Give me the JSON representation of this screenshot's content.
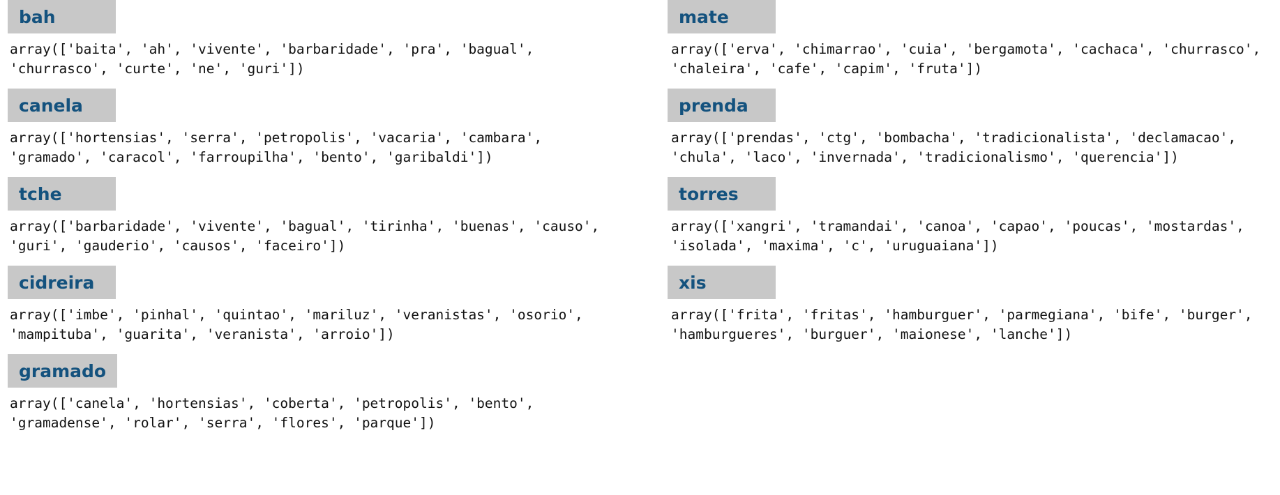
{
  "page": {
    "title": "word association arrays",
    "badge_bg": "#c8c8c8",
    "badge_fg": "#14527e",
    "text_color": "#111111",
    "background": "#ffffff"
  },
  "columns": [
    {
      "name": "left-column",
      "groups": [
        {
          "label": "bah",
          "lines": [
            "array(['baita', 'ah', 'vivente', 'barbaridade', 'pra', 'bagual',",
            "'churrasco', 'curte', 'ne', 'guri'])"
          ],
          "items": [
            "baita",
            "ah",
            "vivente",
            "barbaridade",
            "pra",
            "bagual",
            "churrasco",
            "curte",
            "ne",
            "guri"
          ]
        },
        {
          "label": "canela",
          "lines": [
            "array(['hortensias', 'serra', 'petropolis', 'vacaria', 'cambara',",
            "'gramado', 'caracol', 'farroupilha', 'bento', 'garibaldi'])"
          ],
          "items": [
            "hortensias",
            "serra",
            "petropolis",
            "vacaria",
            "cambara",
            "gramado",
            "caracol",
            "farroupilha",
            "bento",
            "garibaldi"
          ]
        },
        {
          "label": "tche",
          "lines": [
            "array(['barbaridade', 'vivente', 'bagual', 'tirinha', 'buenas', 'causo',",
            "'guri', 'gauderio', 'causos', 'faceiro'])"
          ],
          "items": [
            "barbaridade",
            "vivente",
            "bagual",
            "tirinha",
            "buenas",
            "causo",
            "guri",
            "gauderio",
            "causos",
            "faceiro"
          ]
        },
        {
          "label": "cidreira",
          "lines": [
            "array(['imbe', 'pinhal', 'quintao', 'mariluz', 'veranistas', 'osorio',",
            "'mampituba', 'guarita', 'veranista', 'arroio'])"
          ],
          "items": [
            "imbe",
            "pinhal",
            "quintao",
            "mariluz",
            "veranistas",
            "osorio",
            "mampituba",
            "guarita",
            "veranista",
            "arroio"
          ]
        },
        {
          "label": "gramado",
          "lines": [
            "array(['canela', 'hortensias', 'coberta', 'petropolis', 'bento',",
            "'gramadense', 'rolar', 'serra', 'flores', 'parque'])"
          ],
          "items": [
            "canela",
            "hortensias",
            "coberta",
            "petropolis",
            "bento",
            "gramadense",
            "rolar",
            "serra",
            "flores",
            "parque"
          ]
        }
      ]
    },
    {
      "name": "right-column",
      "groups": [
        {
          "label": "mate",
          "lines": [
            "array(['erva', 'chimarrao', 'cuia', 'bergamota', 'cachaca', 'churrasco',",
            "'chaleira', 'cafe', 'capim', 'fruta'])"
          ],
          "items": [
            "erva",
            "chimarrao",
            "cuia",
            "bergamota",
            "cachaca",
            "churrasco",
            "chaleira",
            "cafe",
            "capim",
            "fruta"
          ]
        },
        {
          "label": "prenda",
          "lines": [
            "array(['prendas', 'ctg', 'bombacha', 'tradicionalista', 'declamacao',",
            "'chula', 'laco', 'invernada', 'tradicionalismo', 'querencia'])"
          ],
          "items": [
            "prendas",
            "ctg",
            "bombacha",
            "tradicionalista",
            "declamacao",
            "chula",
            "laco",
            "invernada",
            "tradicionalismo",
            "querencia"
          ]
        },
        {
          "label": "torres",
          "lines": [
            "array(['xangri', 'tramandai', 'canoa', 'capao', 'poucas', 'mostardas',",
            "'isolada', 'maxima', 'c', 'uruguaiana'])"
          ],
          "items": [
            "xangri",
            "tramandai",
            "canoa",
            "capao",
            "poucas",
            "mostardas",
            "isolada",
            "maxima",
            "c",
            "uruguaiana"
          ]
        },
        {
          "label": "xis",
          "lines": [
            "array(['frita', 'fritas', 'hamburguer', 'parmegiana', 'bife', 'burger',",
            "'hamburgueres', 'burguer', 'maionese', 'lanche'])"
          ],
          "items": [
            "frita",
            "fritas",
            "hamburguer",
            "parmegiana",
            "bife",
            "burger",
            "hamburgueres",
            "burguer",
            "maionese",
            "lanche"
          ]
        }
      ]
    }
  ]
}
